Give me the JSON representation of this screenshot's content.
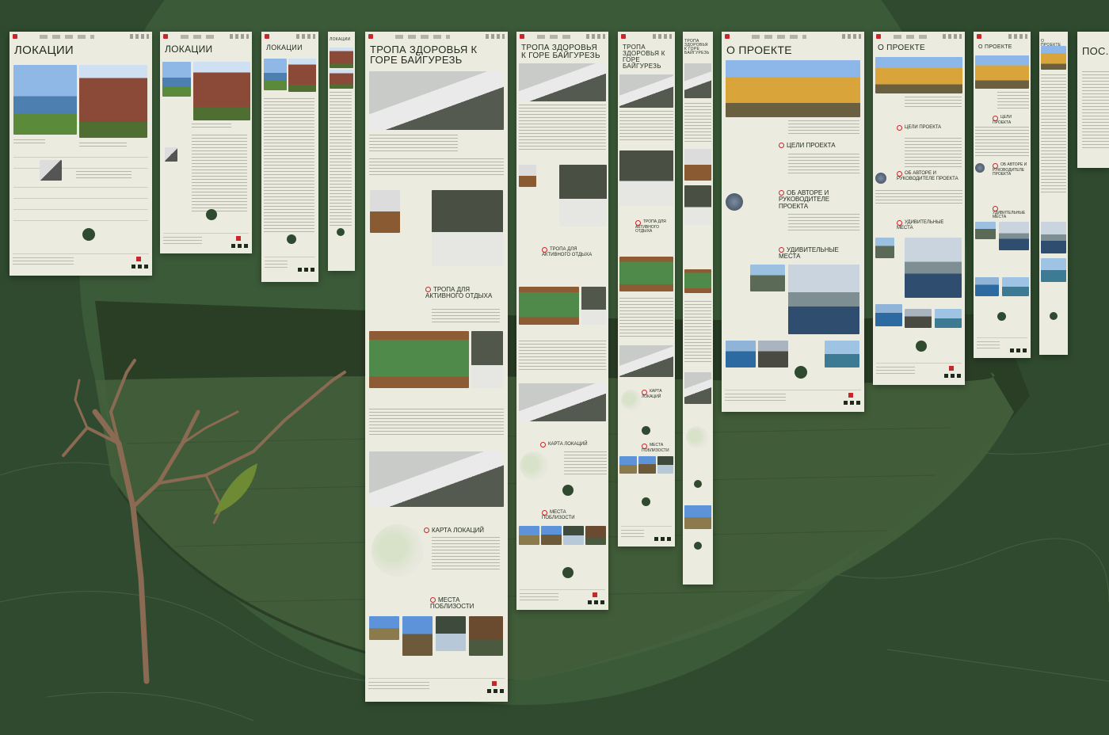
{
  "screens": {
    "s1": {
      "title": "ЛОКАЦИИ"
    },
    "s2": {
      "title": "ЛОКАЦИИ"
    },
    "s3": {
      "title": "ЛОКАЦИИ"
    },
    "s4": {
      "title": "ЛОКАЦИИ"
    },
    "s5": {
      "title": "ТРОПА ЗДОРОВЬЯ К ГОРЕ БАЙГУРЕЗЬ",
      "section1": "ТРОПА ДЛЯ АКТИВНОГО ОТДЫХА",
      "section2": "КАРТА ЛОКАЦИЙ",
      "section3": "МЕСТА ПОБЛИЗОСТИ"
    },
    "s6": {
      "title": "ТРОПА ЗДОРОВЬЯ К ГОРЕ БАЙГУРЕЗЬ",
      "section1": "ТРОПА ДЛЯ АКТИВНОГО ОТДЫХА",
      "section2": "КАРТА ЛОКАЦИЙ",
      "section3": "МЕСТА ПОБЛИЗОСТИ"
    },
    "s7": {
      "title": "ТРОПА ЗДОРОВЬЯ К ГОРЕ БАЙГУРЕЗЬ",
      "section1": "ТРОПА ДЛЯ АКТИВНОГО ОТДЫХА",
      "section2": "КАРТА ЛОКАЦИЙ",
      "section3": "МЕСТА ПОБЛИЗОСТИ"
    },
    "s8": {
      "title": "ТРОПА ЗДОРОВЬЯ К ГОРЕ БАЙГУРЕЗЬ"
    },
    "s9": {
      "title": "О ПРОЕКТЕ",
      "section1": "ЦЕЛИ ПРОЕКТА",
      "section2": "ОБ АВТОРЕ И РУКОВОДИТЕЛЕ ПРОЕКТА",
      "section3": "УДИВИТЕЛЬНЫЕ МЕСТА"
    },
    "s10": {
      "title": "О ПРОЕКТЕ",
      "section1": "ЦЕЛИ ПРОЕКТА",
      "section2": "ОБ АВТОРЕ И РУКОВОДИТЕЛЕ ПРОЕКТА",
      "section3": "УДИВИТЕЛЬНЫЕ МЕСТА"
    },
    "s11": {
      "title": "О ПРОЕКТЕ",
      "section1": "ЦЕЛИ ПРОЕКТА",
      "section2": "ОБ АВТОРЕ И РУКОВОДИТЕЛЕ ПРОЕКТА",
      "section3": "УДИВИТЕЛЬНЫЕ МЕСТА"
    },
    "s12": {
      "title": "О ПРОЕКТЕ"
    },
    "s13": {
      "title": "ПОС..."
    }
  },
  "colors": {
    "background": "#2f4a2e",
    "page": "#ecebe0",
    "accent": "#c8262b",
    "button": "#2f4a2e"
  },
  "icons": [
    "pin-icon",
    "flag-icon",
    "logo-icon",
    "social-icon"
  ]
}
